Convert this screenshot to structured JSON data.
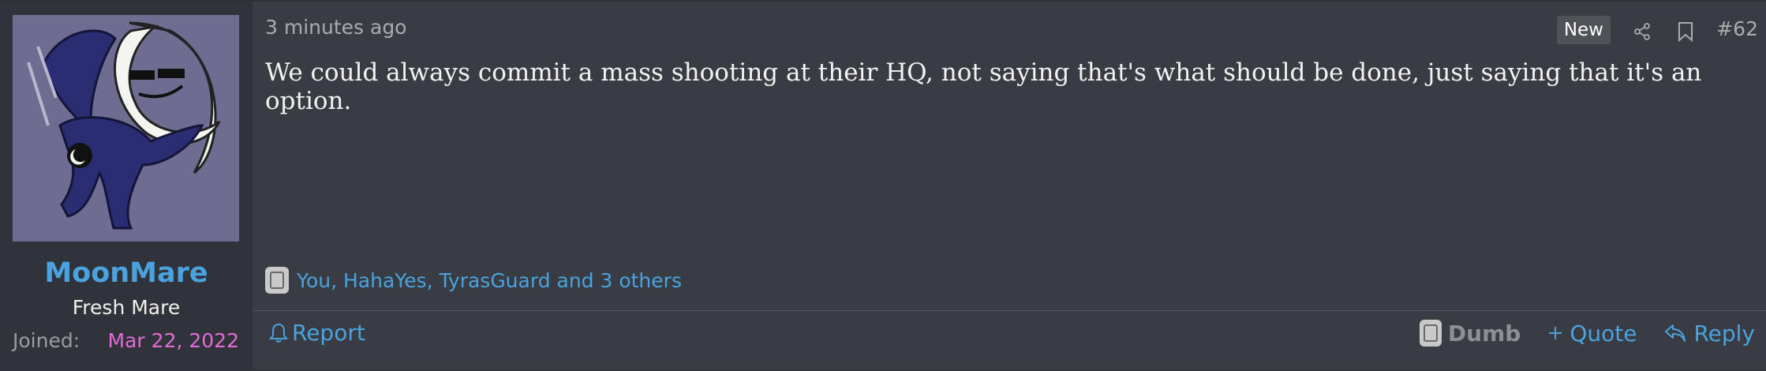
{
  "post": {
    "user": {
      "name": "MoonMare",
      "title": "Fresh Mare",
      "joined_label": "Joined:",
      "joined_date": "Mar 22, 2022"
    },
    "timestamp": "3 minutes ago",
    "badge": "New",
    "post_number": "#62",
    "message": "We could always commit a mass shooting at their HQ, not saying that's what should be done, just saying that it's an option.",
    "reactions_text": "You, HahaYes, TyrasGuard and 3 others",
    "actions": {
      "report": "Report",
      "dumb": "Dumb",
      "quote": "Quote",
      "reply": "Reply"
    },
    "icons": {
      "share": "share-icon",
      "bookmark": "bookmark-icon",
      "bell": "bell-icon",
      "reply": "reply-arrow-icon",
      "quote": "plus-icon"
    }
  }
}
